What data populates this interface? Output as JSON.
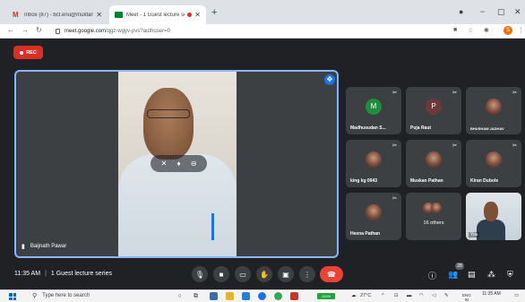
{
  "browser": {
    "tabs": [
      {
        "title": "Inbox (87) - bct.enu@muktanan...",
        "active": false
      },
      {
        "title": "Meet - 1 Guest lecture series",
        "active": true
      }
    ],
    "new_tab": "+",
    "window_controls": {
      "minimize": "−",
      "maximize": "▢",
      "close": "✕"
    },
    "url_host": "meet.google.com",
    "url_path": "/qgz-wgyv-pvs?authuser=0",
    "profile_initial": "S"
  },
  "meeting": {
    "rec_label": "REC",
    "main_speaker": "Baijnath Pawar",
    "time": "11:35 AM",
    "title": "1 Guest lecture series",
    "participants_count": "28"
  },
  "participants": [
    {
      "name": "Madhusudan S...",
      "initial": "M",
      "color": "#1e8e3e",
      "kind": "initial"
    },
    {
      "name": "Puja Raut",
      "initial": "P",
      "color": "#6d3a3a",
      "kind": "initial"
    },
    {
      "name": "BHUSHAM JADHAV",
      "kind": "photo"
    },
    {
      "name": "king kg 0943",
      "kind": "photo"
    },
    {
      "name": "Muskan Pathan",
      "kind": "photo"
    },
    {
      "name": "Kiran Dubole",
      "kind": "photo"
    },
    {
      "name": "Heena Pathan",
      "kind": "photo"
    }
  ],
  "others_tile": {
    "label": "16 others"
  },
  "self_tile": {
    "label": "You"
  },
  "taskbar": {
    "search_placeholder": "Type here to search",
    "battery": "100%",
    "temperature": "27°C",
    "language": "ENG",
    "region": "IN",
    "clock_time": "11:35 AM"
  },
  "colors": {
    "accent": "#8ab4f8",
    "end_call": "#ea4335",
    "rec": "#d93025",
    "meet_bg": "#202124"
  }
}
